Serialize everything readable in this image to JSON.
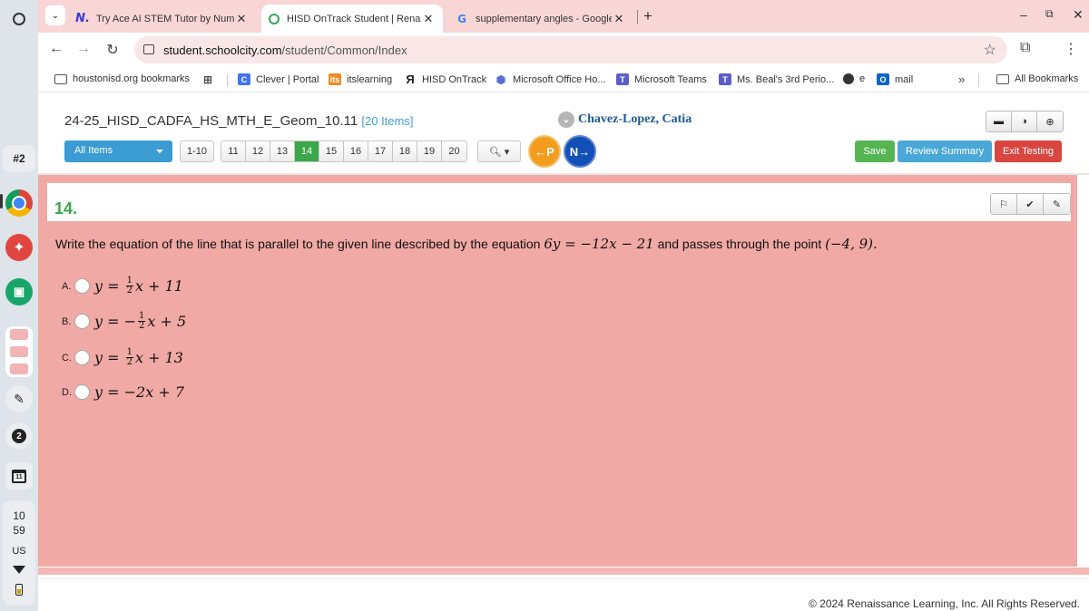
{
  "shelf": {
    "desk": "#2",
    "notifications": "2",
    "calendar_day": "11",
    "clock_hour": "10",
    "clock_min": "59",
    "locale": "US"
  },
  "tabs": [
    {
      "title": "Try Ace AI STEM Tutor by Num",
      "icon": "numerade-icon",
      "active": false
    },
    {
      "title": "HISD OnTrack Student | Renais",
      "icon": "ontrack-ring-icon",
      "active": true
    },
    {
      "title": "supplementary angles - Google",
      "icon": "google-icon",
      "active": false
    }
  ],
  "address": {
    "host": "student.schoolcity.com",
    "path": "/student/Common/Index"
  },
  "bookmarks": [
    {
      "label": "houstonisd.org bookmarks",
      "icon": "folder-icon"
    },
    {
      "label": "",
      "icon": "apps-grid-icon"
    },
    {
      "label": "Clever | Portal",
      "icon": "clever-icon"
    },
    {
      "label": "itslearning",
      "icon": "itslearning-icon"
    },
    {
      "label": "HISD OnTrack",
      "icon": "ontrack-icon"
    },
    {
      "label": "Microsoft Office Ho...",
      "icon": "office-icon"
    },
    {
      "label": "Microsoft Teams",
      "icon": "teams-icon"
    },
    {
      "label": "Ms. Beal's 3rd Perio...",
      "icon": "teams-icon"
    },
    {
      "label": "e",
      "icon": "globe-icon"
    },
    {
      "label": "mail",
      "icon": "outlook-icon"
    },
    {
      "label": "All Bookmarks",
      "icon": "folder-icon"
    }
  ],
  "assessment": {
    "title": "24-25_HISD_CADFA_HS_MTH_E_Geom_10.11",
    "item_count": "[20 Items]",
    "student_name": "Chavez-Lopez, Catia",
    "items_filter": "All Items",
    "range": "1-10",
    "pages": [
      "11",
      "12",
      "13",
      "14",
      "15",
      "16",
      "17",
      "18",
      "19",
      "20"
    ],
    "current_page": "14",
    "prev_label": "P",
    "next_label": "N",
    "save": "Save",
    "review": "Review Summary",
    "exit": "Exit Testing"
  },
  "question": {
    "number": "14.",
    "text_before": "Write the equation of the line that is parallel to the given line described by the equation",
    "given_equation": "6y = −12x − 21",
    "text_middle": "and passes through the point",
    "point": "(−4, 9).",
    "answers": [
      {
        "letter": "A.",
        "lhs": "y =",
        "sign": "",
        "frac_num": "1",
        "frac_den": "2",
        "rest": "x + 11"
      },
      {
        "letter": "B.",
        "lhs": "y =",
        "sign": "−",
        "frac_num": "1",
        "frac_den": "2",
        "rest": "x + 5"
      },
      {
        "letter": "C.",
        "lhs": "y =",
        "sign": "",
        "frac_num": "1",
        "frac_den": "2",
        "rest": "x + 13"
      },
      {
        "letter": "D.",
        "lhs": "y =",
        "sign": "",
        "frac_num": "",
        "frac_den": "",
        "rest": "−2x + 7"
      }
    ]
  },
  "footer": {
    "copyright": "© 2024 Renaissance Learning, Inc. All Rights Reserved."
  },
  "colors": {
    "question_background": "#f0a9a4",
    "current_page": "#3aa84a",
    "save": "#55b552",
    "review": "#4aa8d8",
    "exit": "#d9453f",
    "prev": "#f29d1d",
    "next": "#1250b8"
  }
}
